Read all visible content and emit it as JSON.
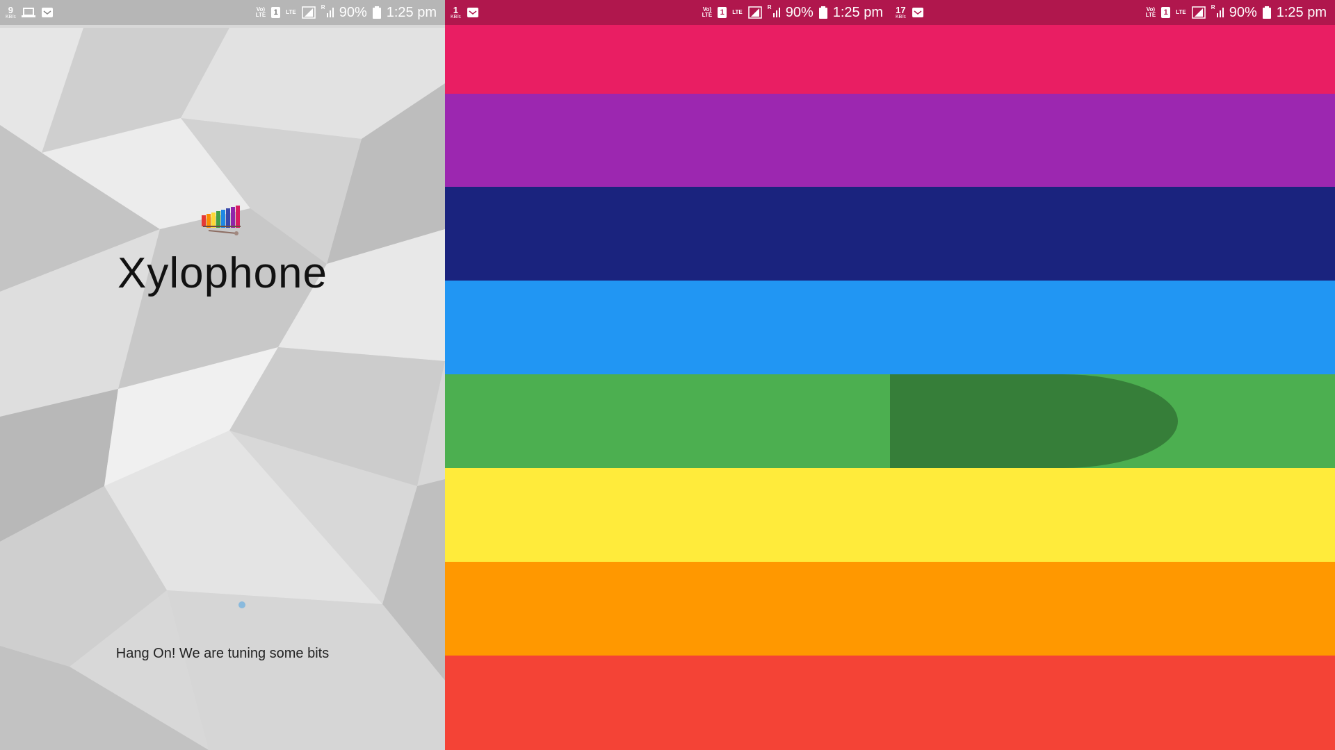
{
  "splash": {
    "status_bar": {
      "speed_value": "9",
      "speed_unit": "KB/s",
      "volte": "Vo)\nLTE",
      "sim": "1",
      "lte": "LTE",
      "roaming": "R",
      "battery": "90%",
      "time": "1:25 pm"
    },
    "app_title": "Xylophone",
    "logo_icon": "xylophone-icon",
    "loading_text": "Hang On! We are tuning some bits",
    "background": "#d6d6d6"
  },
  "xylophone": {
    "status_bar_left": {
      "speed_value": "1",
      "speed_unit": "KB/s",
      "volte": "Vo)\nLTE",
      "sim": "1",
      "lte": "LTE",
      "roaming": "R",
      "battery": "90%",
      "time": "1:25 pm"
    },
    "status_bar_right": {
      "speed_value": "17",
      "speed_unit": "KB/s",
      "volte": "Vo)\nLTE",
      "sim": "1",
      "lte": "LTE",
      "roaming": "R",
      "battery": "90%",
      "time": "1:25 pm"
    },
    "status_bar_color": "#b0174d",
    "pressed_key_index": 4,
    "keys": [
      {
        "name": "pink",
        "color": "#e91e63"
      },
      {
        "name": "purple",
        "color": "#9c27b0"
      },
      {
        "name": "indigo",
        "color": "#1a237e"
      },
      {
        "name": "blue",
        "color": "#2196f3"
      },
      {
        "name": "green",
        "color": "#4caf50"
      },
      {
        "name": "yellow",
        "color": "#ffeb3b"
      },
      {
        "name": "orange",
        "color": "#ff9800"
      },
      {
        "name": "red",
        "color": "#f44336"
      }
    ]
  }
}
